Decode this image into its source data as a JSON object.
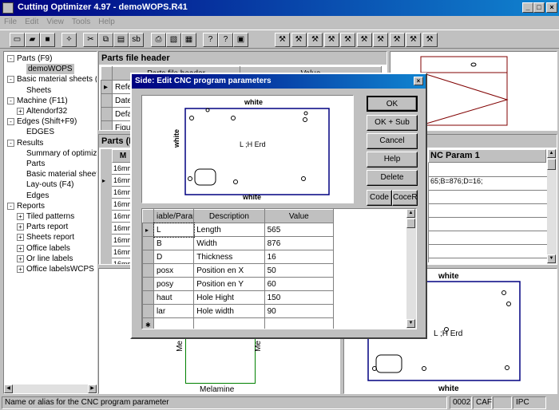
{
  "app": {
    "title": "Cutting Optimizer 4.97 - demoWOPS.R41",
    "min": "_",
    "max": "□",
    "close": "×"
  },
  "menu": [
    "File",
    "Edit",
    "View",
    "Tools",
    "Help"
  ],
  "tree": [
    {
      "label": "Parts (F9)",
      "lvl": 0,
      "exp": "-"
    },
    {
      "label": "demoWOPS",
      "lvl": 1,
      "sel": true
    },
    {
      "label": "Basic material sheets (F",
      "lvl": 0,
      "exp": "-"
    },
    {
      "label": "Sheets",
      "lvl": 1
    },
    {
      "label": "Machine (F11)",
      "lvl": 0,
      "exp": "-"
    },
    {
      "label": "Altendorf32",
      "lvl": 1,
      "exp": "+"
    },
    {
      "label": "Edges (Shift+F9)",
      "lvl": 0,
      "exp": "-"
    },
    {
      "label": "EDGES",
      "lvl": 1
    },
    {
      "label": "Results",
      "lvl": 0,
      "exp": "-"
    },
    {
      "label": "Summary of optimiz",
      "lvl": 1
    },
    {
      "label": "Parts",
      "lvl": 1
    },
    {
      "label": "Basic material sheet",
      "lvl": 1
    },
    {
      "label": "Lay-outs (F4)",
      "lvl": 1
    },
    {
      "label": "Edges",
      "lvl": 1
    },
    {
      "label": "Reports",
      "lvl": 0,
      "exp": "-"
    },
    {
      "label": "Tiled patterns",
      "lvl": 1,
      "exp": "+"
    },
    {
      "label": "Parts report",
      "lvl": 1,
      "exp": "+"
    },
    {
      "label": "Sheets report",
      "lvl": 1,
      "exp": "+"
    },
    {
      "label": "Office labels",
      "lvl": 1,
      "exp": "+"
    },
    {
      "label": "Or line labels",
      "lvl": 1,
      "exp": "+"
    },
    {
      "label": "Office labelsWCPS",
      "lvl": 1,
      "exp": "+"
    }
  ],
  "header_panel": {
    "title": "Parts file header",
    "col1": "Parts file header",
    "col2": "Value",
    "rows": [
      "Refer",
      "Date",
      "Defau",
      "Figure"
    ]
  },
  "parts_panel": {
    "title": "Parts (F",
    "col1": "M",
    "col_cnc": "NC Param 1",
    "cnc_val": "65;B=876;D=16;",
    "rows": [
      "16mm",
      "16mm",
      "16mm",
      "16mm",
      "16mm",
      "16mm",
      "16mm",
      "16mm",
      "16mm"
    ]
  },
  "dialog": {
    "title": "Side: Edit CNC program parameters",
    "buttons": {
      "ok": "OK",
      "ok_sub": "OK + Sub",
      "cancel": "Cancel",
      "help": "Help",
      "delete": "Delete",
      "code": "Code",
      "coder": "CoceR"
    },
    "preview": {
      "top": "white",
      "bottom": "white",
      "left": "white",
      "center": "L ;H Erd"
    },
    "table": {
      "headers": [
        "iable/Param",
        "Description",
        "Value"
      ],
      "rows": [
        [
          "L",
          "Length",
          "565"
        ],
        [
          "B",
          "Width",
          "876"
        ],
        [
          "D",
          "Thickness",
          "16"
        ],
        [
          "posx",
          "Position en X",
          "50"
        ],
        [
          "posy",
          "Position en Y",
          "60"
        ],
        [
          "haut",
          "Hole Hight",
          "150"
        ],
        [
          "lar",
          "Hole width",
          "90"
        ]
      ]
    }
  },
  "right_preview": {
    "top": "white",
    "bottom": "white",
    "center": "L ;H Erd"
  },
  "bottom_preview": {
    "label": "Melamine",
    "side": "Me"
  },
  "status": {
    "text": "Name or alias for the CNC program parameter",
    "f1": "0002",
    "f2": "CAF",
    "f3": "",
    "f4": "IPC"
  }
}
